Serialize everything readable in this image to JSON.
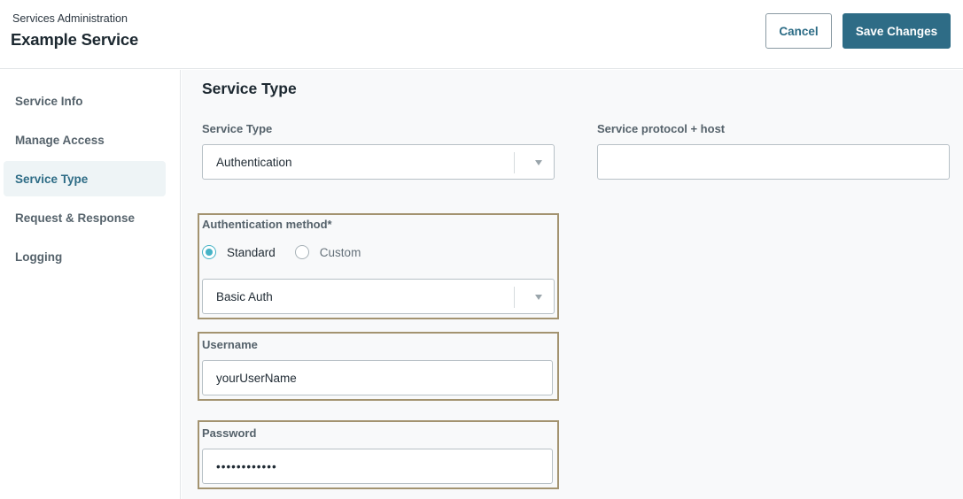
{
  "header": {
    "breadcrumb": "Services Administration",
    "title": "Example Service",
    "cancel_label": "Cancel",
    "save_label": "Save Changes"
  },
  "sidebar": {
    "items": [
      {
        "label": "Service Info",
        "active": false
      },
      {
        "label": "Manage Access",
        "active": false
      },
      {
        "label": "Service Type",
        "active": true
      },
      {
        "label": "Request & Response",
        "active": false
      },
      {
        "label": "Logging",
        "active": false
      }
    ]
  },
  "main": {
    "section_title": "Service Type",
    "service_type": {
      "label": "Service Type",
      "value": "Authentication"
    },
    "protocol_host": {
      "label": "Service protocol + host",
      "value": ""
    },
    "auth_method": {
      "label": "Authentication method*",
      "options": [
        "Standard",
        "Custom"
      ],
      "selected": "Standard",
      "select_value": "Basic Auth"
    },
    "username": {
      "label": "Username",
      "value": "yourUserName"
    },
    "password": {
      "label": "Password",
      "value": "••••••••••••"
    }
  },
  "colors": {
    "accent": "#2e6c86",
    "radio_accent": "#46b3c6",
    "highlight_border": "#a39370"
  }
}
